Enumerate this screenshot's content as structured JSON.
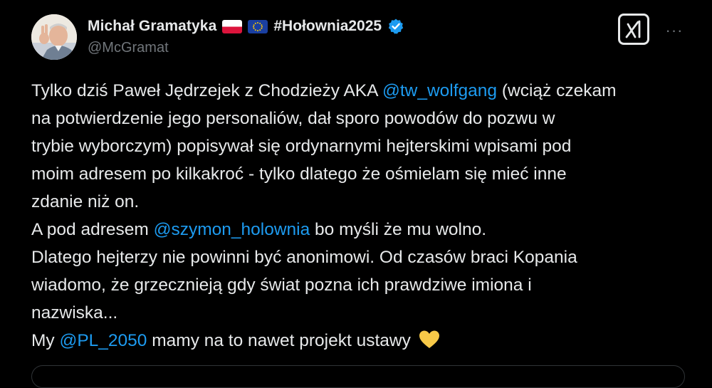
{
  "author": {
    "display_name": "Michał Gramatyka",
    "hashtag": "#Hołownia2025",
    "handle": "@McGramat"
  },
  "icons": {
    "flag_1": "poland-flag-icon",
    "flag_2": "eu-flag-icon",
    "verified": "verified-badge-icon",
    "grok": "grok-icon",
    "more": "more-icon",
    "heart": "yellow-heart-icon"
  },
  "actions": {
    "more_label": "···"
  },
  "colors": {
    "background": "#000000",
    "text": "#e7e9ea",
    "secondary": "#71767b",
    "mention": "#1d9bf0",
    "heart": "#f7c948"
  },
  "tweet": {
    "l1a": "Tylko dziś Paweł Jędrzejek z Chodzieży AKA ",
    "l1m": "@tw_wolfgang",
    "l1b": " (wciąż czekam",
    "l2": "na potwierdzenie jego personaliów, dał sporo powodów do pozwu w",
    "l3": "trybie wyborczym) popisywał się ordynarnymi hejterskimi wpisami pod",
    "l4": "moim adresem po kilkakroć - tylko dlatego że ośmielam się mieć inne",
    "l5": "zdanie niż on.",
    "l6a": "A pod adresem ",
    "l6m": "@szymon_holownia",
    "l6b": " bo myśli że mu wolno.",
    "l7": "Dlatego hejterzy nie powinni być anonimowi. Od czasów braci Kopania",
    "l8": "wiadomo, że grzecznieją gdy świat pozna ich prawdziwe imiona i",
    "l9": "nazwiska...",
    "l10a": "My ",
    "l10m": "@PL_2050",
    "l10b": " mamy na to nawet projekt ustawy "
  }
}
